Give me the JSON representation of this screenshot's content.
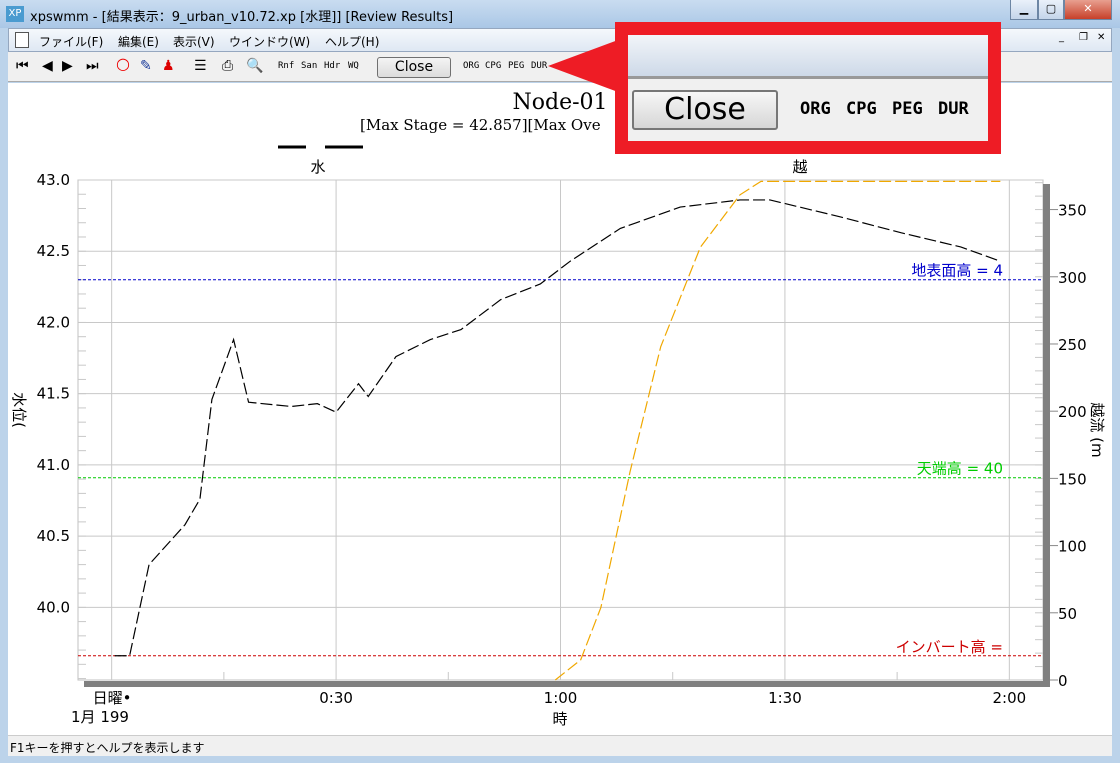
{
  "window": {
    "title": "xpswmm - [結果表示：9_urban_v10.72.xp [水理]] [Review Results]",
    "icon": "XP"
  },
  "menu": [
    "ファイル(F)",
    "編集(E)",
    "表示(V)",
    "ウインドウ(W)",
    "ヘルプ(H)"
  ],
  "toolbar": {
    "text_buttons": [
      "Rnf",
      "San",
      "Hdr",
      "WQ"
    ],
    "close_label": "Close",
    "mode_buttons": [
      "ORG",
      "CPG",
      "PEG",
      "DUR"
    ]
  },
  "callout": {
    "close_label": "Close",
    "mode_buttons": [
      "ORG",
      "CPG",
      "PEG",
      "DUR"
    ]
  },
  "status": "F1キーを押すとヘルプを表示します",
  "chart_data": {
    "type": "line",
    "title": "Node-01",
    "subtitle": "[Max Stage = 42.857][Max Ove",
    "legend": [
      "水",
      "越"
    ],
    "ylabel": "水位(",
    "y2label": "越流 (m",
    "xlabel": "時",
    "x_start_labels": [
      "日曜•",
      "1月 199"
    ],
    "xticks": [
      {
        "min": 30,
        "label": "0:30"
      },
      {
        "min": 60,
        "label": "1:00"
      },
      {
        "min": 90,
        "label": "1:30"
      },
      {
        "min": 120,
        "label": "2:00"
      }
    ],
    "xlim": [
      -4.5,
      124.5
    ],
    "ylim": [
      39.49,
      43.0
    ],
    "y2lim": [
      0,
      372
    ],
    "yticks": [
      "43.0",
      "42.5",
      "42.0",
      "41.5",
      "41.0",
      "40.5",
      "40.0"
    ],
    "y2ticks": [
      "350",
      "300",
      "250",
      "200",
      "150",
      "100",
      "50",
      "0"
    ],
    "ref_lines": [
      {
        "label": "地表面高 = 4",
        "value": 42.3,
        "color": "#0000cc"
      },
      {
        "label": "天端高 = 40",
        "value": 40.91,
        "color": "#00cc00"
      },
      {
        "label": "インバート高 =",
        "value": 39.66,
        "color": "#cc0000"
      }
    ],
    "series": [
      {
        "name": "水",
        "axis": "left",
        "color": "#000000",
        "points": [
          [
            0.4,
            39.66
          ],
          [
            2.4,
            39.66
          ],
          [
            5,
            40.3
          ],
          [
            9.8,
            40.58
          ],
          [
            11.8,
            40.76
          ],
          [
            13.4,
            41.46
          ],
          [
            16.3,
            41.88
          ],
          [
            18.3,
            41.44
          ],
          [
            24,
            41.41
          ],
          [
            27.5,
            41.43
          ],
          [
            30,
            41.37
          ],
          [
            33,
            41.57
          ],
          [
            34.3,
            41.48
          ],
          [
            38,
            41.76
          ],
          [
            42.6,
            41.88
          ],
          [
            46.7,
            41.95
          ],
          [
            52,
            42.16
          ],
          [
            57.3,
            42.27
          ],
          [
            61.3,
            42.43
          ],
          [
            68,
            42.66
          ],
          [
            76,
            42.81
          ],
          [
            84,
            42.86
          ],
          [
            88,
            42.86
          ],
          [
            97.5,
            42.74
          ],
          [
            105.5,
            42.63
          ],
          [
            113.5,
            42.53
          ],
          [
            118.8,
            42.43
          ]
        ]
      },
      {
        "name": "越",
        "axis": "right",
        "color": "#f0a800",
        "points": [
          [
            59.3,
            0
          ],
          [
            62.7,
            15
          ],
          [
            65.4,
            54
          ],
          [
            69.3,
            155
          ],
          [
            73.4,
            248
          ],
          [
            78.7,
            322
          ],
          [
            84,
            361
          ],
          [
            86.8,
            371
          ],
          [
            118.8,
            371
          ]
        ]
      }
    ]
  }
}
